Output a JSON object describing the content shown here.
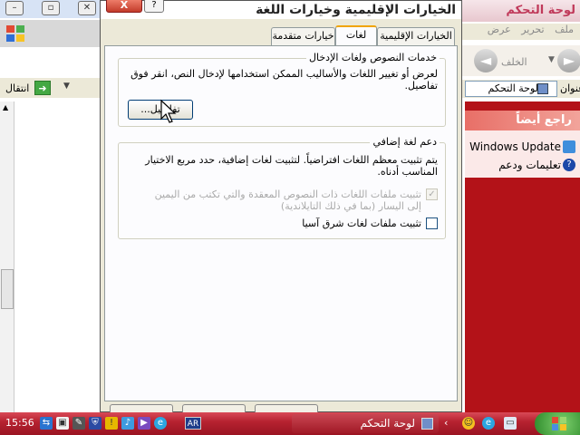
{
  "dialog": {
    "title": "الخيارات الإقليمية وخيارات اللغة",
    "help_label": "?",
    "close_label": "X",
    "tabs": [
      {
        "label": "الخيارات الإقليمية",
        "active": false
      },
      {
        "label": "لغات",
        "active": true
      },
      {
        "label": "خيارات متقدمة",
        "active": false
      }
    ],
    "text_services": {
      "title": "خدمات النصوص ولغات الإدخال",
      "description": "لعرض أو تغيير اللغات والأساليب الممكن استخدامها لإدخال النص، انقر فوق تفاصيل.",
      "details_button": "تفاصيل..."
    },
    "supplemental": {
      "title": "دعم لغة إضافي",
      "description": "يتم تثبيت معظم اللغات افتراضياً. لتثبيت لغات إضافية، حدد مربع الاختيار المناسب أدناه.",
      "complex_script": {
        "label": "تثبيت ملفات اللغات ذات النصوص المعقدة والتي تكتب من اليمين إلى اليسار (بما في ذلك التايلاندية)",
        "checked": true,
        "enabled": false
      },
      "east_asian": {
        "label": "تثبيت ملفات لغات شرق آسيا",
        "checked": false,
        "enabled": true
      }
    }
  },
  "control_panel": {
    "title": "لوحة التحكم",
    "menu": [
      "ملف",
      "تحرير",
      "عرض"
    ],
    "back_label": "الخلف",
    "address_label": "عنوان",
    "address_value": "لوحة التحكم",
    "see_also_title": "راجع أيضاً",
    "see_also_items": [
      "Windows Update",
      "تعليمات ودعم"
    ]
  },
  "background_window": {
    "go_label": "انتقال"
  },
  "taskbar": {
    "clock": "15:56",
    "language": "AR",
    "task_label": "لوحة التحكم",
    "arrow": "‹"
  },
  "colors": {
    "accent": "#b31218",
    "tab_highlight": "#f0a400"
  }
}
